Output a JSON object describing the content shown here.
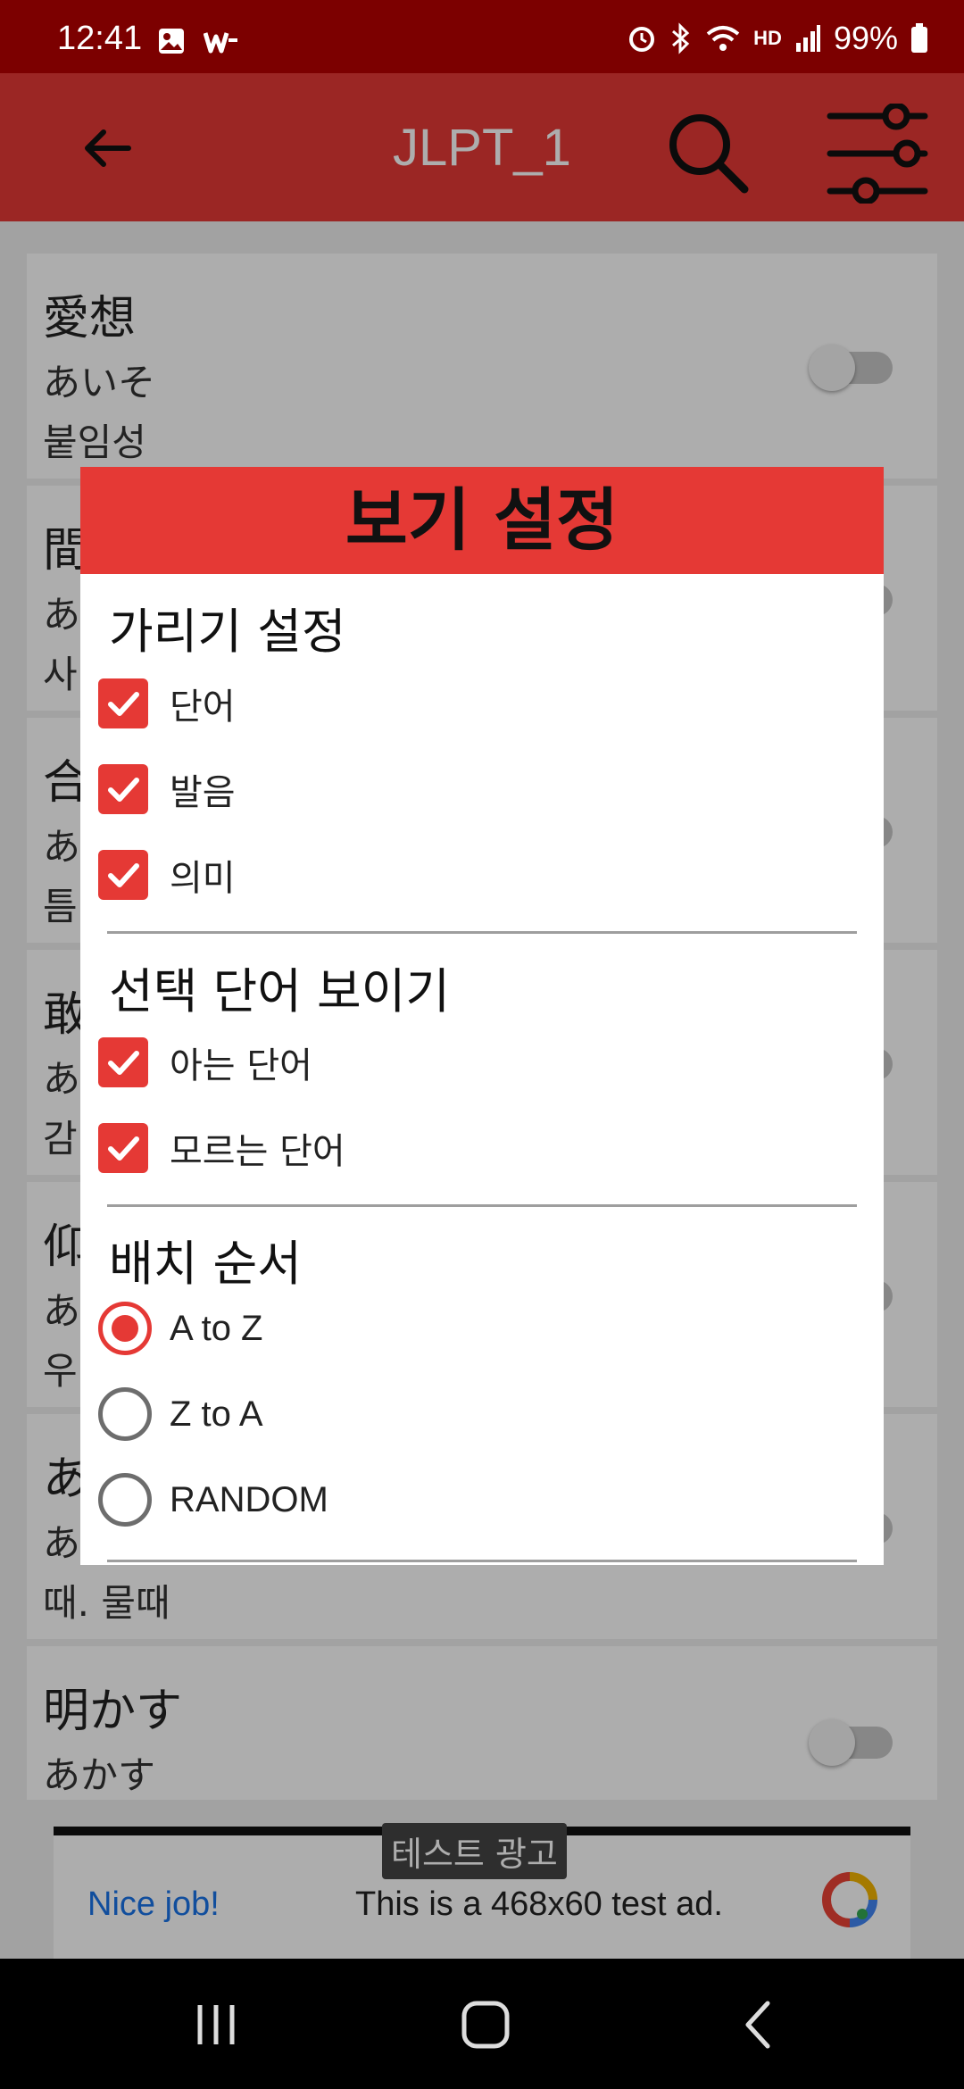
{
  "status_bar": {
    "time": "12:41",
    "battery": "99%",
    "network_label": "HD"
  },
  "app_bar": {
    "title": "JLPT_1",
    "back_icon": "arrow-left",
    "search_icon": "magnifier",
    "settings_icon": "tune-sliders"
  },
  "word_list": [
    {
      "kanji": "愛想",
      "kana": "あいそ",
      "meaning": "붙임성"
    },
    {
      "kanji": "間",
      "kana": "あ",
      "meaning": "사"
    },
    {
      "kanji": "合",
      "kana": "あ",
      "meaning": "틈"
    },
    {
      "kanji": "敢",
      "kana": "あ",
      "meaning": "감"
    },
    {
      "kanji": "仰",
      "kana": "あ",
      "meaning": "우"
    },
    {
      "kanji": "あ",
      "kana": "あ",
      "meaning": "때. 물때"
    },
    {
      "kanji": "明かす",
      "kana": "あかす",
      "meaning": ""
    }
  ],
  "dialog": {
    "title": "보기 설정",
    "hide_section": {
      "title": "가리기 설정",
      "options": [
        {
          "label": "단어",
          "checked": true
        },
        {
          "label": "발음",
          "checked": true
        },
        {
          "label": "의미",
          "checked": true
        }
      ]
    },
    "show_section": {
      "title": "선택 단어 보이기",
      "options": [
        {
          "label": "아는 단어",
          "checked": true
        },
        {
          "label": "모르는 단어",
          "checked": true
        }
      ]
    },
    "order_section": {
      "title": "배치 순서",
      "options": [
        {
          "label": "A to Z",
          "selected": true
        },
        {
          "label": "Z to A",
          "selected": false
        },
        {
          "label": "RANDOM",
          "selected": false
        }
      ]
    }
  },
  "ad": {
    "tag": "테스트 광고",
    "headline": "Nice job!",
    "body": "This is a 468x60 test ad."
  },
  "colors": {
    "accent": "#e53935",
    "status_bar": "#7c0000"
  }
}
